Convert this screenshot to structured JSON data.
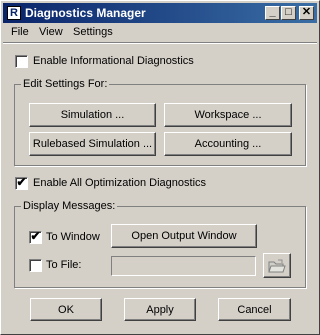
{
  "window": {
    "title": "Diagnostics Manager",
    "title_icon": "app-icon",
    "controls": [
      "minimize-icon",
      "maximize-icon",
      "close-icon"
    ]
  },
  "menu": {
    "items": [
      "File",
      "View",
      "Settings"
    ]
  },
  "enable_info": {
    "label": "Enable Informational Diagnostics",
    "checked": false
  },
  "edit_settings": {
    "title": "Edit Settings For:",
    "buttons": [
      "Simulation ...",
      "Workspace ...",
      "Rulebased Simulation ...",
      "Accounting ..."
    ]
  },
  "enable_opt": {
    "label": "Enable All Optimization Diagnostics",
    "checked": true
  },
  "display_messages": {
    "title": "Display Messages:",
    "to_window": {
      "label": "To Window",
      "checked": true
    },
    "open_output": "Open Output Window",
    "to_file": {
      "label": "To File:",
      "checked": false
    },
    "file_value": "",
    "browse_icon": "folder-icon"
  },
  "footer": {
    "ok": "OK",
    "apply": "Apply",
    "cancel": "Cancel"
  }
}
